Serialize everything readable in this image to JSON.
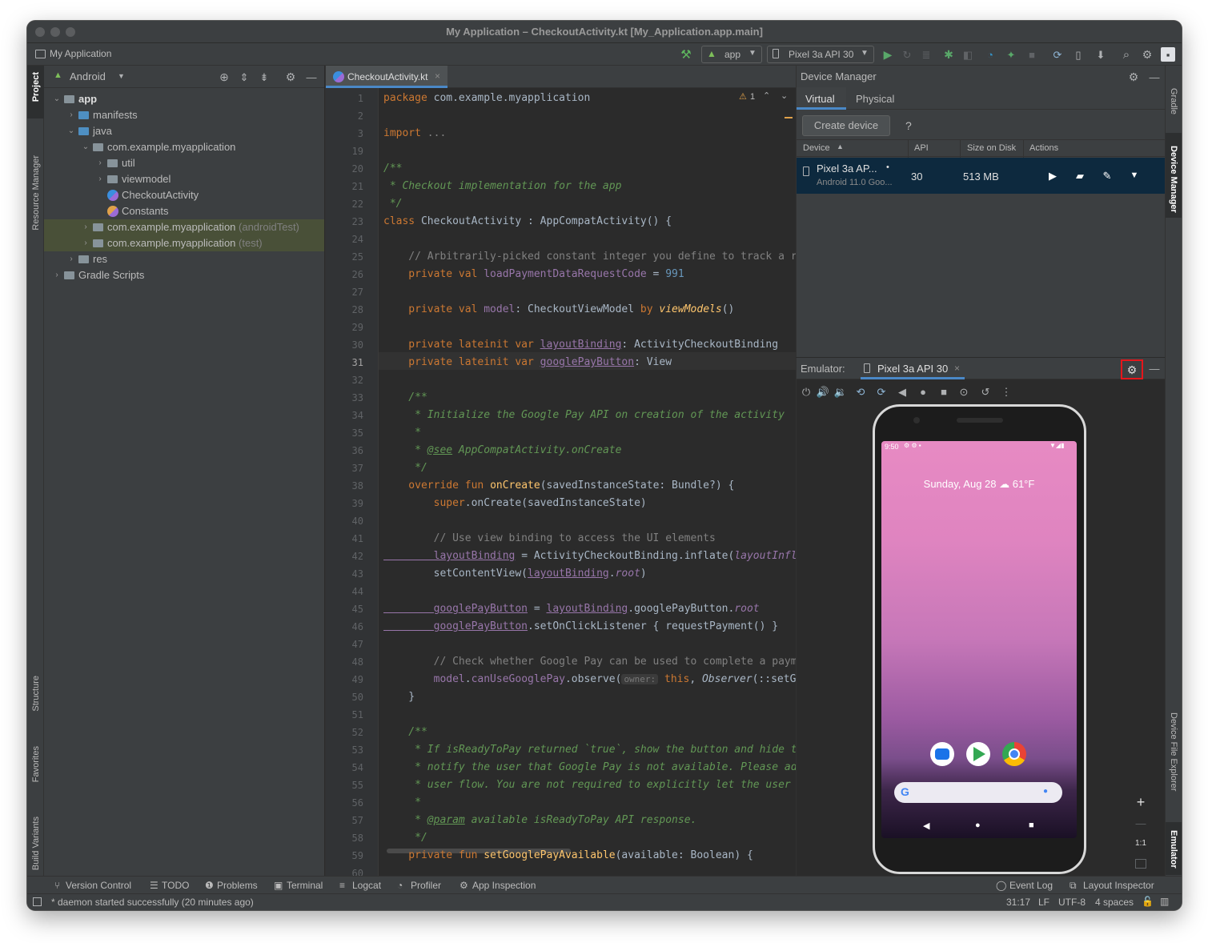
{
  "window": {
    "title": "My Application – CheckoutActivity.kt [My_Application.app.main]"
  },
  "navbar": {
    "project": "My Application",
    "run_config": "app",
    "device": "Pixel 3a API 30"
  },
  "left_tool_windows": [
    "Project",
    "Resource Manager",
    "Structure",
    "Favorites",
    "Build Variants"
  ],
  "right_tool_windows": [
    "Gradle",
    "Device Manager",
    "Device File Explorer",
    "Emulator"
  ],
  "project_panel": {
    "view": "Android",
    "tree": [
      {
        "label": "app",
        "level": 0,
        "arrow": "⌄",
        "icon": "module",
        "bold": true
      },
      {
        "label": "manifests",
        "level": 1,
        "arrow": "›",
        "icon": "folder-blue"
      },
      {
        "label": "java",
        "level": 1,
        "arrow": "⌄",
        "icon": "folder-blue"
      },
      {
        "label": "com.example.myapplication",
        "level": 2,
        "arrow": "⌄",
        "icon": "package"
      },
      {
        "label": "util",
        "level": 3,
        "arrow": "›",
        "icon": "package"
      },
      {
        "label": "viewmodel",
        "level": 3,
        "arrow": "›",
        "icon": "package"
      },
      {
        "label": "CheckoutActivity",
        "level": 3,
        "arrow": "",
        "icon": "kotlin-class"
      },
      {
        "label": "Constants",
        "level": 3,
        "arrow": "",
        "icon": "kotlin-object"
      },
      {
        "label": "com.example.myapplication",
        "suffix": "(androidTest)",
        "level": 2,
        "arrow": "›",
        "icon": "package",
        "highlight": true
      },
      {
        "label": "com.example.myapplication",
        "suffix": "(test)",
        "level": 2,
        "arrow": "›",
        "icon": "package",
        "highlight": true
      },
      {
        "label": "res",
        "level": 1,
        "arrow": "›",
        "icon": "res"
      },
      {
        "label": "Gradle Scripts",
        "level": 0,
        "arrow": "›",
        "icon": "gradle"
      }
    ]
  },
  "editor": {
    "tab": "CheckoutActivity.kt",
    "warnings": "1",
    "current_line": "31",
    "lines": [
      {
        "n": "1",
        "s": [
          [
            "kw",
            "package "
          ],
          [
            "",
            "com.example.myapplication"
          ]
        ]
      },
      {
        "n": "2",
        "s": []
      },
      {
        "n": "3",
        "s": [
          [
            "kw",
            "import "
          ],
          [
            "cm",
            "..."
          ]
        ]
      },
      {
        "n": "19",
        "s": []
      },
      {
        "n": "20",
        "s": [
          [
            "doc",
            "/**"
          ]
        ]
      },
      {
        "n": "21",
        "s": [
          [
            "doc",
            " * Checkout implementation for the app"
          ]
        ]
      },
      {
        "n": "22",
        "s": [
          [
            "doc",
            " */"
          ]
        ]
      },
      {
        "n": "23",
        "s": [
          [
            "kw",
            "class "
          ],
          [
            "",
            "CheckoutActivity : AppCompatActivity() {"
          ]
        ]
      },
      {
        "n": "24",
        "s": []
      },
      {
        "n": "25",
        "s": [
          [
            "cm",
            "    // Arbitrarily-picked constant integer you define to track a r"
          ]
        ]
      },
      {
        "n": "26",
        "s": [
          [
            "kw",
            "    private val "
          ],
          [
            "prop",
            "loadPaymentDataRequestCode"
          ],
          [
            "",
            " = "
          ],
          [
            "num",
            "991"
          ]
        ]
      },
      {
        "n": "27",
        "s": []
      },
      {
        "n": "28",
        "s": [
          [
            "kw",
            "    private val "
          ],
          [
            "prop",
            "model"
          ],
          [
            "",
            ": CheckoutViewModel "
          ],
          [
            "kw",
            "by "
          ],
          [
            "fn it",
            "viewModels"
          ],
          [
            "",
            "()"
          ]
        ]
      },
      {
        "n": "29",
        "s": []
      },
      {
        "n": "30",
        "s": [
          [
            "kw",
            "    private lateinit var "
          ],
          [
            "prop ul",
            "layoutBinding"
          ],
          [
            "",
            ": ActivityCheckoutBinding"
          ]
        ]
      },
      {
        "n": "31",
        "s": [
          [
            "kw",
            "    private lateinit var "
          ],
          [
            "prop ul",
            "googlePayButton"
          ],
          [
            "",
            ": View"
          ]
        ]
      },
      {
        "n": "32",
        "s": []
      },
      {
        "n": "33",
        "s": [
          [
            "doc",
            "    /**"
          ]
        ]
      },
      {
        "n": "34",
        "s": [
          [
            "doc",
            "     * Initialize the Google Pay API on creation of the activity"
          ]
        ]
      },
      {
        "n": "35",
        "s": [
          [
            "doc",
            "     *"
          ]
        ]
      },
      {
        "n": "36",
        "s": [
          [
            "doc",
            "     * "
          ],
          [
            "doc ul",
            "@see"
          ],
          [
            "doc",
            " AppCompatActivity.onCreate"
          ]
        ]
      },
      {
        "n": "37",
        "s": [
          [
            "doc",
            "     */"
          ]
        ]
      },
      {
        "n": "38",
        "s": [
          [
            "kw",
            "    override fun "
          ],
          [
            "fn",
            "onCreate"
          ],
          [
            "",
            "(savedInstanceState: Bundle?) {"
          ]
        ]
      },
      {
        "n": "39",
        "s": [
          [
            "kw",
            "        super"
          ],
          [
            "",
            ".onCreate(savedInstanceState)"
          ]
        ]
      },
      {
        "n": "40",
        "s": []
      },
      {
        "n": "41",
        "s": [
          [
            "cm",
            "        // Use view binding to access the UI elements"
          ]
        ]
      },
      {
        "n": "42",
        "s": [
          [
            "prop ul",
            "        layoutBinding"
          ],
          [
            "",
            " = ActivityCheckoutBinding.inflate("
          ],
          [
            "prop it",
            "layoutInfl"
          ]
        ]
      },
      {
        "n": "43",
        "s": [
          [
            "",
            "        setContentView("
          ],
          [
            "prop ul",
            "layoutBinding"
          ],
          [
            "",
            "."
          ],
          [
            "prop it",
            "root"
          ],
          [
            "",
            ")"
          ]
        ]
      },
      {
        "n": "44",
        "s": []
      },
      {
        "n": "45",
        "s": [
          [
            "prop ul",
            "        googlePayButton"
          ],
          [
            "",
            " = "
          ],
          [
            "prop ul",
            "layoutBinding"
          ],
          [
            "",
            ".googlePayButton."
          ],
          [
            "prop it",
            "root"
          ]
        ]
      },
      {
        "n": "46",
        "s": [
          [
            "prop ul",
            "        googlePayButton"
          ],
          [
            "",
            ".setOnClickListener { requestPayment() }"
          ]
        ]
      },
      {
        "n": "47",
        "s": []
      },
      {
        "n": "48",
        "s": [
          [
            "cm",
            "        // Check whether Google Pay can be used to complete a paym"
          ]
        ]
      },
      {
        "n": "49",
        "s": [
          [
            "prop",
            "        model"
          ],
          [
            "",
            "."
          ],
          [
            "prop",
            "canUseGooglePay"
          ],
          [
            "",
            ".observe("
          ],
          [
            "hint",
            "owner:"
          ],
          [
            "kw",
            " this"
          ],
          [
            "",
            ", "
          ],
          [
            "it",
            "Observer"
          ],
          [
            "",
            "(::setG"
          ]
        ]
      },
      {
        "n": "50",
        "s": [
          [
            "",
            "    }"
          ]
        ]
      },
      {
        "n": "51",
        "s": []
      },
      {
        "n": "52",
        "s": [
          [
            "doc",
            "    /**"
          ]
        ]
      },
      {
        "n": "53",
        "s": [
          [
            "doc",
            "     * If isReadyToPay returned `true`, show the button and hide t"
          ]
        ]
      },
      {
        "n": "54",
        "s": [
          [
            "doc",
            "     * notify the user that Google Pay is not available. Please ad"
          ]
        ]
      },
      {
        "n": "55",
        "s": [
          [
            "doc",
            "     * user flow. You are not required to explicitly let the user"
          ]
        ]
      },
      {
        "n": "56",
        "s": [
          [
            "doc",
            "     *"
          ]
        ]
      },
      {
        "n": "57",
        "s": [
          [
            "doc",
            "     * "
          ],
          [
            "doc ul",
            "@param"
          ],
          [
            "doc",
            " available isReadyToPay API response."
          ]
        ]
      },
      {
        "n": "58",
        "s": [
          [
            "doc",
            "     */"
          ]
        ]
      },
      {
        "n": "59",
        "s": [
          [
            "kw",
            "    private fun "
          ],
          [
            "fn",
            "setGooglePayAvailable"
          ],
          [
            "",
            "(available: Boolean) {"
          ]
        ]
      },
      {
        "n": "60",
        "s": []
      }
    ]
  },
  "device_manager": {
    "title": "Device Manager",
    "tabs": [
      "Virtual",
      "Physical"
    ],
    "create_button": "Create device",
    "help": "?",
    "columns": [
      "Device",
      "API",
      "Size on Disk",
      "Actions"
    ],
    "device": {
      "name": "Pixel 3a AP...",
      "dot": "•",
      "subtitle": "Android 11.0 Goo...",
      "api": "30",
      "size": "513 MB"
    }
  },
  "emulator": {
    "label": "Emulator:",
    "tab": "Pixel 3a API 30",
    "phone": {
      "status_time": "9:50",
      "widget": "Sunday, Aug 28 ☁ 61°F"
    },
    "zoom_label": "1:1"
  },
  "bottom_tools": [
    "Version Control",
    "TODO",
    "Problems",
    "Terminal",
    "Logcat",
    "Profiler",
    "App Inspection"
  ],
  "bottom_tools_right": [
    "Event Log",
    "Layout Inspector"
  ],
  "status": {
    "message": "* daemon started successfully (20 minutes ago)",
    "position": "31:17",
    "line_sep": "LF",
    "encoding": "UTF-8",
    "indent": "4 spaces"
  },
  "colors": {
    "highlight_box": "#e5161b",
    "selection": "#0d293e",
    "accent": "#4a88c7"
  }
}
